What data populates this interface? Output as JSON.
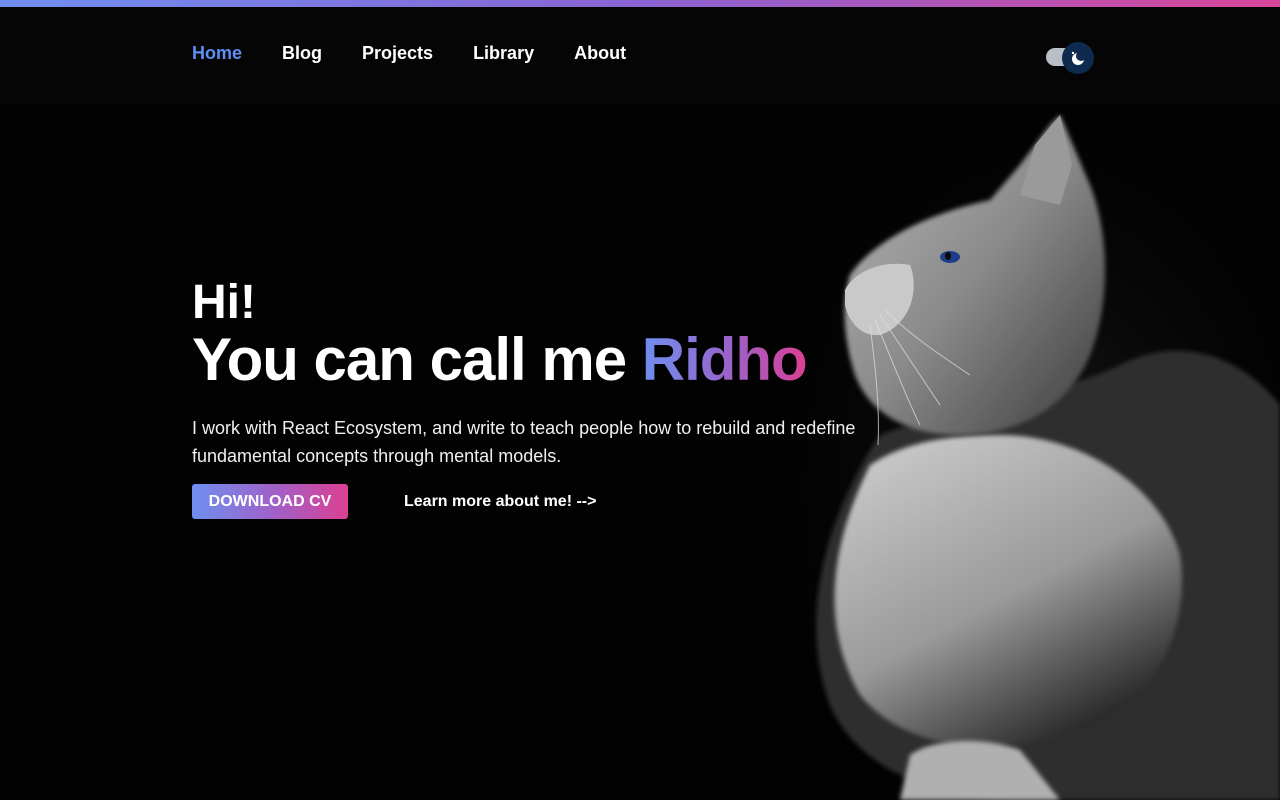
{
  "nav": {
    "items": [
      {
        "label": "Home",
        "active": true
      },
      {
        "label": "Blog",
        "active": false
      },
      {
        "label": "Projects",
        "active": false
      },
      {
        "label": "Library",
        "active": false
      },
      {
        "label": "About",
        "active": false
      }
    ]
  },
  "theme_toggle": {
    "icon": "moon-icon",
    "state": "dark"
  },
  "hero": {
    "greeting": "Hi!",
    "headline_prefix": "You can call me",
    "name": "Ridho",
    "description": "I work with React Ecosystem, and write to teach people how to rebuild and redefine fundamental concepts through mental models.",
    "cta_primary": "DOWNLOAD CV",
    "cta_secondary": "Learn more about me! -->"
  },
  "colors": {
    "accent_blue": "#5f8ef5",
    "gradient_start": "#6f8ff0",
    "gradient_end": "#dd3f92",
    "background": "#050505"
  },
  "image": {
    "subject": "cat-photo"
  }
}
